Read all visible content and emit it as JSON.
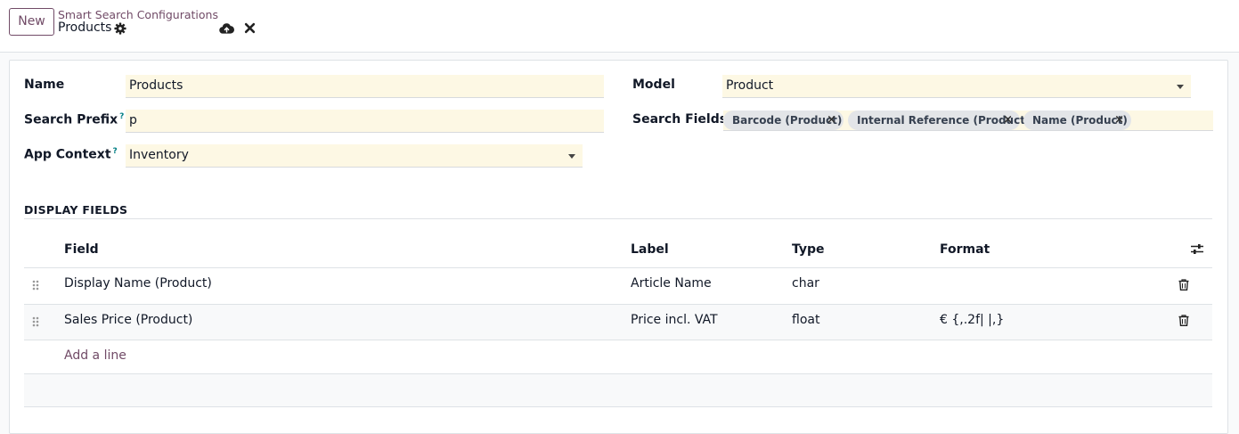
{
  "control_panel": {
    "new_button": "New",
    "breadcrumb": "Smart Search Configurations",
    "record_title": "Products",
    "icons": [
      "gear-icon",
      "cloud-upload-icon",
      "close-icon"
    ]
  },
  "form": {
    "name": {
      "label": "Name",
      "value": "Products"
    },
    "search_prefix": {
      "label": "Search Prefix",
      "help": "?",
      "value": "p"
    },
    "app_context": {
      "label": "App Context",
      "help": "?",
      "value": "Inventory"
    },
    "model": {
      "label": "Model",
      "value": "Product"
    },
    "search_fields": {
      "label": "Search Fields",
      "tags": [
        "Barcode (Product)",
        "Internal Reference (Product)",
        "Name (Product)"
      ],
      "remove_glyph": "×"
    }
  },
  "display_fields": {
    "section_title": "DISPLAY FIELDS",
    "columns": [
      "Field",
      "Label",
      "Type",
      "Format"
    ],
    "rows": [
      {
        "field": "Display Name (Product)",
        "label": "Article Name",
        "type": "char",
        "format": ""
      },
      {
        "field": "Sales Price (Product)",
        "label": "Price incl. VAT",
        "type": "float",
        "format": "€ {,.2f| |,}"
      }
    ],
    "add_line": "Add a line"
  },
  "colors": {
    "brand": "#714b67",
    "required_field_bg": "#fdf8e4",
    "tag_bg": "#e3e5e8",
    "help_marker": "#017e84"
  }
}
